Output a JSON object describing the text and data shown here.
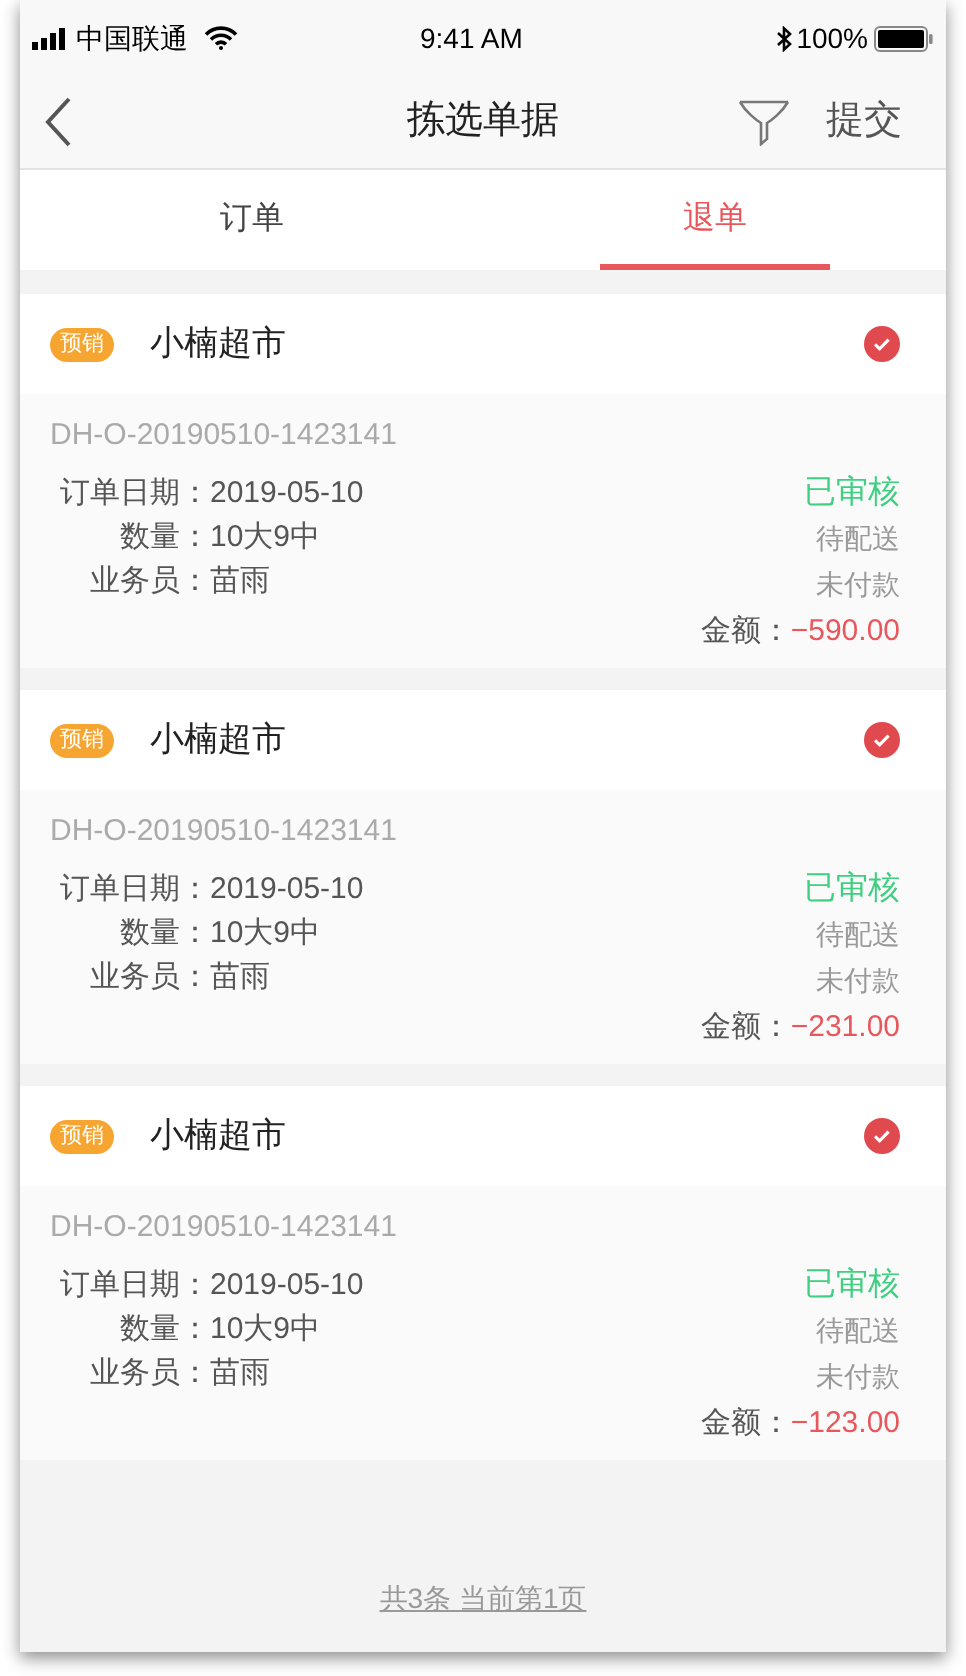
{
  "status_bar": {
    "carrier": "中国联通",
    "time": "9:41 AM",
    "battery": "100%"
  },
  "header": {
    "title": "拣选单据",
    "action": "提交"
  },
  "tabs": [
    {
      "label": "订单",
      "selected": false
    },
    {
      "label": "退单",
      "selected": true
    }
  ],
  "orders": [
    {
      "tag": "预销",
      "customer": "小楠超市",
      "checked": true,
      "number": "DH-O-20190510-1423141",
      "fields": [
        {
          "label": "订单日期：",
          "value": "2019-05-10"
        },
        {
          "label": "数量：",
          "value": "10大9中"
        },
        {
          "label": "业务员：",
          "value": "苗雨"
        }
      ],
      "audit_status": "已审核",
      "delivery_status": "待配送",
      "payment_status": "未付款",
      "amount_label": "金额：",
      "amount": "−590.00"
    },
    {
      "tag": "预销",
      "customer": "小楠超市",
      "checked": true,
      "number": "DH-O-20190510-1423141",
      "fields": [
        {
          "label": "订单日期：",
          "value": "2019-05-10"
        },
        {
          "label": "数量：",
          "value": "10大9中"
        },
        {
          "label": "业务员：",
          "value": "苗雨"
        }
      ],
      "audit_status": "已审核",
      "delivery_status": "待配送",
      "payment_status": "未付款",
      "amount_label": "金额：",
      "amount": "−231.00"
    },
    {
      "tag": "预销",
      "customer": "小楠超市",
      "checked": true,
      "number": "DH-O-20190510-1423141",
      "fields": [
        {
          "label": "订单日期：",
          "value": "2019-05-10"
        },
        {
          "label": "数量：",
          "value": "10大9中"
        },
        {
          "label": "业务员：",
          "value": "苗雨"
        }
      ],
      "audit_status": "已审核",
      "delivery_status": "待配送",
      "payment_status": "未付款",
      "amount_label": "金额：",
      "amount": "−123.00"
    }
  ],
  "footer": {
    "pagination": "共3条 当前第1页"
  }
}
